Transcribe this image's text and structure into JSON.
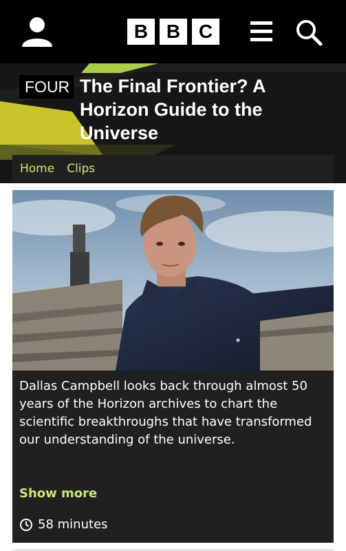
{
  "header": {
    "logo_letters": [
      "B",
      "B",
      "C"
    ],
    "icons": {
      "account": "user-icon",
      "menu": "hamburger-menu-icon",
      "search": "search-icon"
    }
  },
  "programme": {
    "channel": "FOUR",
    "title": "The Final Frontier? A Horizon Guide to the Universe"
  },
  "nav": {
    "items": [
      {
        "label": "Home"
      },
      {
        "label": "Clips"
      }
    ]
  },
  "card": {
    "description": "Dallas Campbell looks back through almost 50 years of the Horizon archives to chart the scientific breakthroughs that have transformed our understanding of the universe.",
    "show_more": "Show more",
    "duration": "58 minutes",
    "duration_icon": "clock-icon"
  },
  "colors": {
    "accent": "#c8e87a",
    "background_dark": "#000000",
    "card": "#202020",
    "header_art_yellow": "#c9c42a",
    "header_art_green": "#a9cf4a"
  }
}
